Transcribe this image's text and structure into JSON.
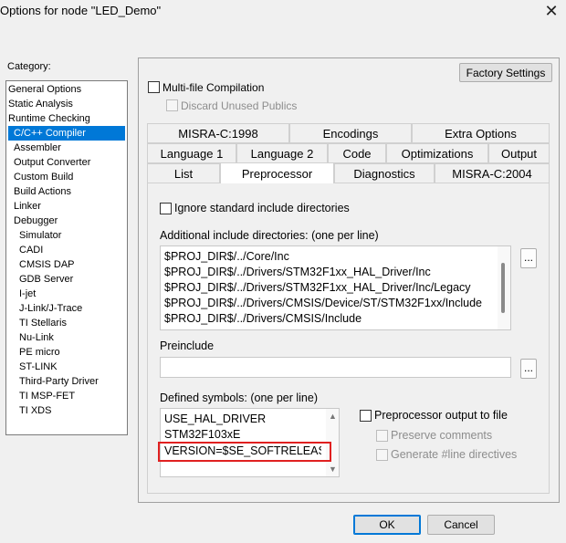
{
  "window": {
    "title": "Options for node \"LED_Demo\"",
    "close_label": "X"
  },
  "category": {
    "label": "Category:",
    "items": [
      {
        "label": "General Options",
        "indent": 0
      },
      {
        "label": "Static Analysis",
        "indent": 0
      },
      {
        "label": "Runtime Checking",
        "indent": 0
      },
      {
        "label": "C/C++ Compiler",
        "indent": 1
      },
      {
        "label": "Assembler",
        "indent": 1
      },
      {
        "label": "Output Converter",
        "indent": 1
      },
      {
        "label": "Custom Build",
        "indent": 1
      },
      {
        "label": "Build Actions",
        "indent": 1
      },
      {
        "label": "Linker",
        "indent": 1
      },
      {
        "label": "Debugger",
        "indent": 1
      },
      {
        "label": "Simulator",
        "indent": 2
      },
      {
        "label": "CADI",
        "indent": 2
      },
      {
        "label": "CMSIS DAP",
        "indent": 2
      },
      {
        "label": "GDB Server",
        "indent": 2
      },
      {
        "label": "I-jet",
        "indent": 2
      },
      {
        "label": "J-Link/J-Trace",
        "indent": 2
      },
      {
        "label": "TI Stellaris",
        "indent": 2
      },
      {
        "label": "Nu-Link",
        "indent": 2
      },
      {
        "label": "PE micro",
        "indent": 2
      },
      {
        "label": "ST-LINK",
        "indent": 2
      },
      {
        "label": "Third-Party Driver",
        "indent": 2
      },
      {
        "label": "TI MSP-FET",
        "indent": 2
      },
      {
        "label": "TI XDS",
        "indent": 2
      }
    ],
    "selected": "C/C++ Compiler"
  },
  "options": {
    "factory_settings": "Factory Settings",
    "multi_file": "Multi-file Compilation",
    "discard_unused": "Discard Unused Publics"
  },
  "tabs": {
    "row1": [
      "MISRA-C:1998",
      "Encodings",
      "Extra Options"
    ],
    "row2": [
      "Language 1",
      "Language 2",
      "Code",
      "Optimizations",
      "Output"
    ],
    "row3": [
      "List",
      "Preprocessor",
      "Diagnostics",
      "MISRA-C:2004"
    ],
    "active": "Preprocessor"
  },
  "preprocessor": {
    "ignore_std": "Ignore standard include directories",
    "include_label": "Additional include directories: (one per line)",
    "include_dirs": [
      "$PROJ_DIR$/../Core/Inc",
      "$PROJ_DIR$/../Drivers/STM32F1xx_HAL_Driver/Inc",
      "$PROJ_DIR$/../Drivers/STM32F1xx_HAL_Driver/Inc/Legacy",
      "$PROJ_DIR$/../Drivers/CMSIS/Device/ST/STM32F1xx/Include",
      "$PROJ_DIR$/../Drivers/CMSIS/Include"
    ],
    "browse": "...",
    "preinclude_label": "Preinclude",
    "preinclude_value": "",
    "defined_label": "Defined symbols: (one per line)",
    "defined_symbols": [
      "USE_HAL_DRIVER",
      "STM32F103xE",
      "VERSION=$SE_SOFTRELEASE"
    ],
    "pp_output": "Preprocessor output to file",
    "preserve_comments": "Preserve comments",
    "gen_line": "Generate #line directives"
  },
  "footer": {
    "ok": "OK",
    "cancel": "Cancel"
  }
}
